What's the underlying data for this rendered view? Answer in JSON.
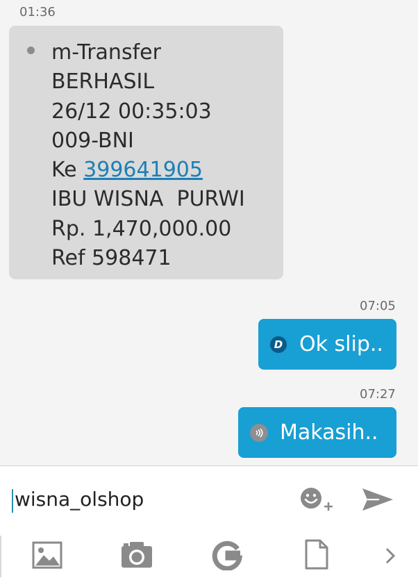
{
  "messages": {
    "incoming": {
      "time": "01:36",
      "lines": [
        "m-Transfer",
        "BERHASIL",
        "26/12 00:35:03",
        "009-BNI"
      ],
      "account_prefix": "Ke ",
      "account_link": "399641905",
      "lines_after": [
        "IBU WISNA  PURWI",
        "Rp. 1,470,000.00",
        "Ref 598471"
      ]
    },
    "outgoing": [
      {
        "time": "07:05",
        "badge": "D",
        "text": "Ok slip.."
      },
      {
        "time": "07:27",
        "text": "Makasih.."
      }
    ]
  },
  "composer": {
    "input_value": "wisna_olshop"
  },
  "toolbar_icons": [
    "gallery-icon",
    "camera-icon",
    "g-sticker-icon",
    "document-icon",
    "chevron-right-icon"
  ],
  "colors": {
    "outgoing_bubble": "#189fd4",
    "incoming_bubble": "#dadada",
    "link": "#1d7fb4"
  }
}
